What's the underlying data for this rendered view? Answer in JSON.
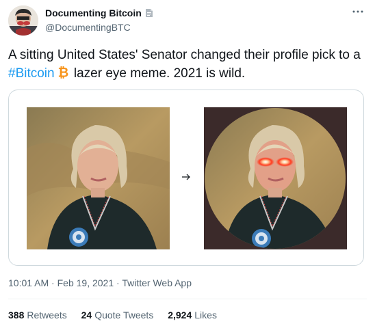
{
  "author": {
    "display_name": "Documenting Bitcoin",
    "handle": "@DocumentingBTC",
    "avatar_icon": "avatar-portrait",
    "badge_icon": "document-icon"
  },
  "tweet": {
    "text_before": "A sitting United States' Senator changed their profile pick to a ",
    "hashtag": "#Bitcoin",
    "text_after": " lazer eye meme. 2021 is wild.",
    "emoji_icon": "bitcoin-icon"
  },
  "media": {
    "arrow_glyph": "→"
  },
  "meta": {
    "time": "10:01 AM",
    "sep1": " · ",
    "date": "Feb 19, 2021",
    "sep2": " · ",
    "source": "Twitter Web App"
  },
  "stats": {
    "retweets_count": "388",
    "retweets_label": "Retweets",
    "quotes_count": "24",
    "quotes_label": "Quote Tweets",
    "likes_count": "2,924",
    "likes_label": "Likes"
  },
  "colors": {
    "link": "#1d9bf0",
    "secondary_text": "#536471",
    "border": "#cfd9de",
    "bitcoin_orange": "#f7931a"
  }
}
